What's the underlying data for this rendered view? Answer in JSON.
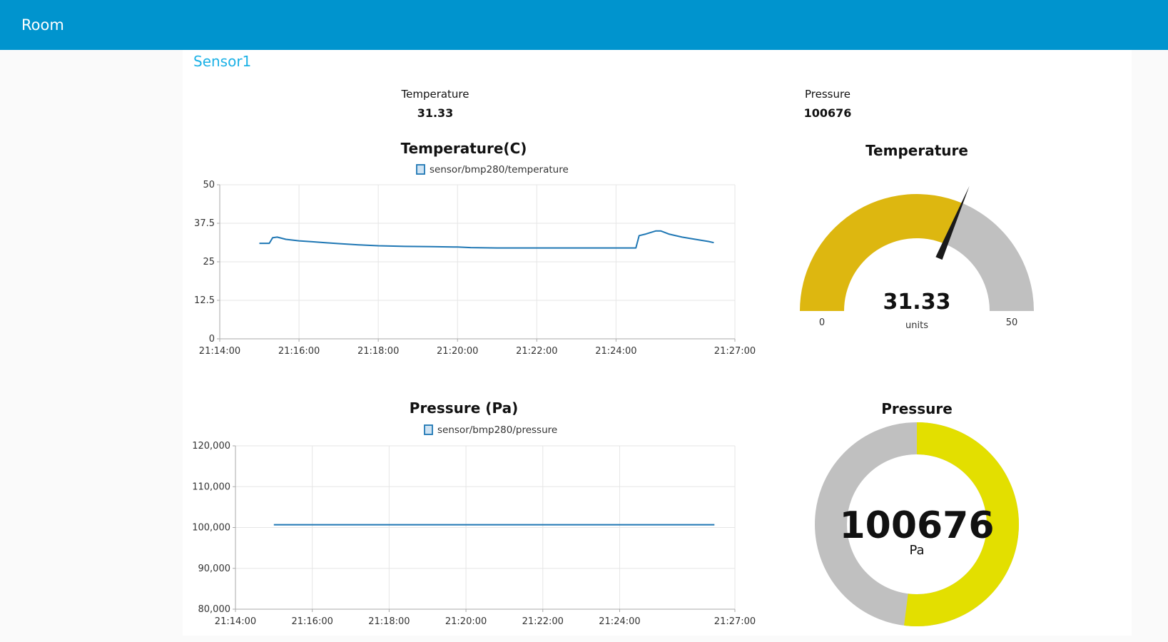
{
  "app": {
    "title": "Room"
  },
  "group": {
    "title": "Sensor1"
  },
  "texts": {
    "temperature": {
      "label": "Temperature",
      "value": "31.33"
    },
    "pressure": {
      "label": "Pressure",
      "value": "100676"
    }
  },
  "gauges": {
    "temperature": {
      "title": "Temperature",
      "value": 31.33,
      "value_text": "31.33",
      "units": "units",
      "min": 0,
      "max": 50,
      "min_text": "0",
      "max_text": "50",
      "color_fill": "#ddb710",
      "color_bg": "#c0c0c0",
      "color_needle": "#1a1a1a"
    },
    "pressure": {
      "title": "Pressure",
      "value": 100676,
      "value_text": "100676",
      "units": "Pa",
      "fraction": 0.52,
      "color_fill": "#e3df00",
      "color_bg": "#c0c0c0"
    }
  },
  "colors": {
    "header": "#0094ce",
    "group_title": "#1bb1e6",
    "series": "#1f77b4",
    "grid": "#e8e8e8"
  },
  "chart_data": [
    {
      "type": "line",
      "title": "Temperature(C)",
      "legend": "top",
      "grid": true,
      "xlabel": "",
      "ylabel": "",
      "xlim": [
        "21:14:00",
        "21:27:00"
      ],
      "ylim": [
        0,
        50
      ],
      "xticks": [
        "21:14:00",
        "21:16:00",
        "21:18:00",
        "21:20:00",
        "21:22:00",
        "21:24:00",
        "21:27:00"
      ],
      "yticks": [
        "0",
        "12.5",
        "25",
        "37.5",
        "50"
      ],
      "series": [
        {
          "name": "sensor/bmp280/temperature",
          "color": "#1f77b4",
          "x": [
            "21:15:00",
            "21:15:15",
            "21:15:20",
            "21:15:27",
            "21:15:40",
            "21:16:00",
            "21:16:20",
            "21:16:40",
            "21:17:00",
            "21:17:30",
            "21:18:00",
            "21:18:40",
            "21:19:20",
            "21:20:00",
            "21:20:20",
            "21:21:00",
            "21:22:00",
            "21:23:00",
            "21:24:00",
            "21:24:30",
            "21:24:35",
            "21:24:45",
            "21:25:00",
            "21:25:08",
            "21:25:20",
            "21:25:40",
            "21:26:00",
            "21:26:20",
            "21:26:28"
          ],
          "y": [
            31.0,
            31.0,
            32.8,
            33.0,
            32.3,
            31.8,
            31.5,
            31.2,
            30.9,
            30.5,
            30.2,
            30.0,
            29.9,
            29.8,
            29.6,
            29.5,
            29.5,
            29.5,
            29.5,
            29.5,
            33.5,
            34.0,
            35.0,
            35.0,
            34.0,
            33.0,
            32.3,
            31.6,
            31.2
          ]
        }
      ]
    },
    {
      "type": "line",
      "title": "Pressure (Pa)",
      "legend": "top",
      "grid": true,
      "xlabel": "",
      "ylabel": "",
      "xlim": [
        "21:14:00",
        "21:27:00"
      ],
      "ylim": [
        80000,
        120000
      ],
      "xticks": [
        "21:14:00",
        "21:16:00",
        "21:18:00",
        "21:20:00",
        "21:22:00",
        "21:24:00",
        "21:27:00"
      ],
      "yticks": [
        "80,000",
        "90,000",
        "100,000",
        "110,000",
        "120,000"
      ],
      "series": [
        {
          "name": "sensor/bmp280/pressure",
          "color": "#1f77b4",
          "x": [
            "21:15:00",
            "21:26:28"
          ],
          "y": [
            100676,
            100676
          ]
        }
      ]
    }
  ]
}
